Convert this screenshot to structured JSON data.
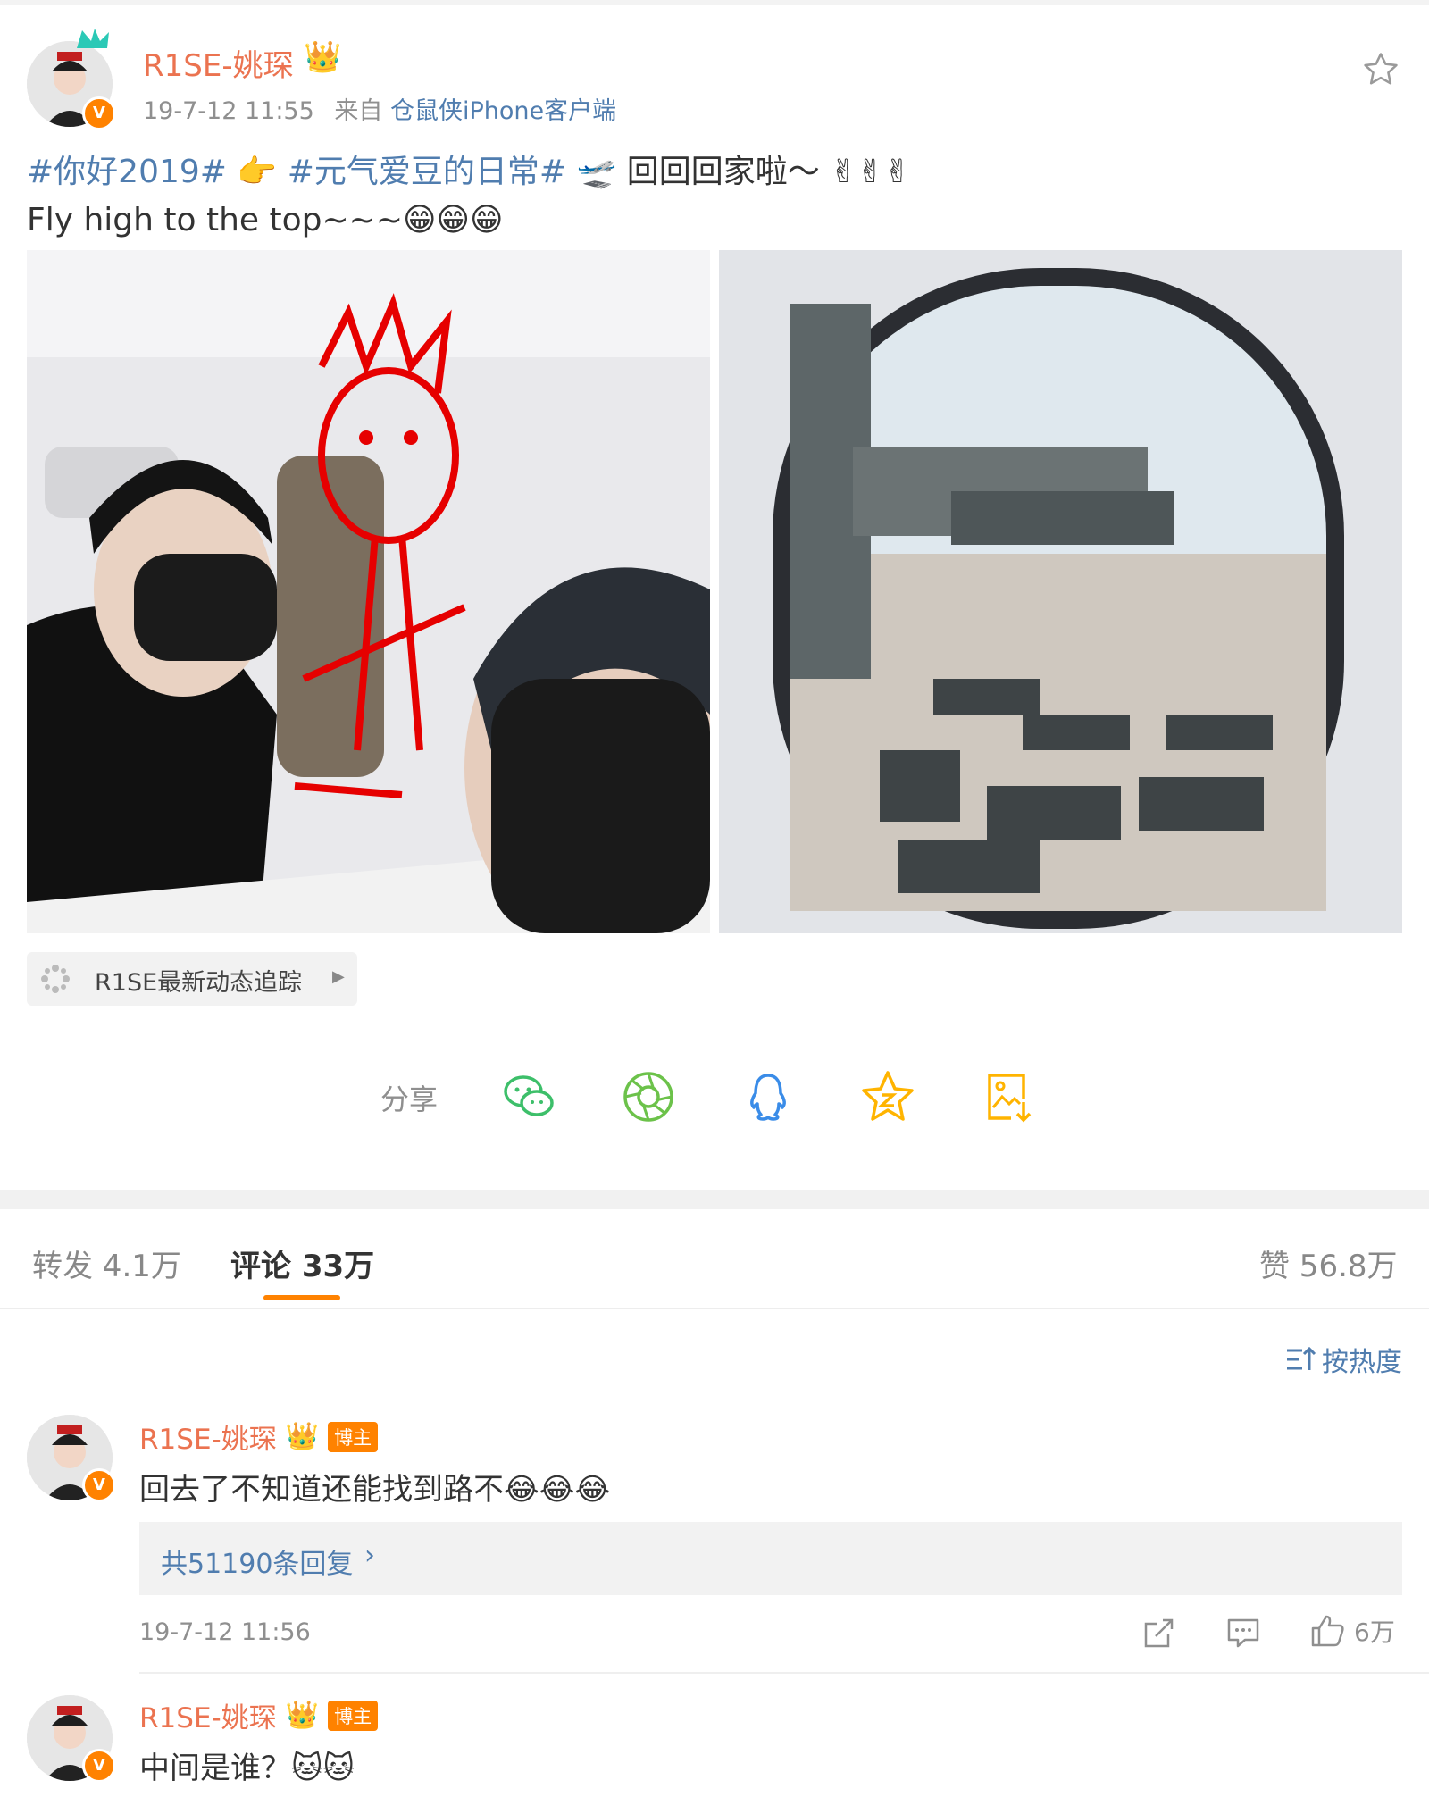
{
  "post": {
    "author": "R1SE-姚琛",
    "timestamp": "19-7-12 11:55",
    "source_prefix": "来自",
    "source": "仓鼠侠iPhone客户端",
    "text_line1": {
      "topic1": "#你好2019#",
      "topic2": "#元气爱豆的日常#",
      "text": "回回回家啦～",
      "emojis": "✌✌✌"
    },
    "text_line2": {
      "text": "Fly high to the top~~~",
      "emojis": "😁😁😁"
    },
    "superchat_link": "R1SE最新动态追踪",
    "share_label": "分享"
  },
  "tabs": {
    "repost": "转发 4.1万",
    "comments": "评论 33万",
    "likes": "赞 56.8万"
  },
  "sort_label": "按热度",
  "comments": [
    {
      "author": "R1SE-姚琛",
      "badge": "博主",
      "text": "回去了不知道还能找到路不",
      "emojis": "😂😂😂",
      "replies": "共51190条回复",
      "time": "19-7-12 11:56",
      "likes": "6万"
    },
    {
      "author": "R1SE-姚琛",
      "badge": "博主",
      "text": "中间是谁？",
      "emojis": "🐱🐱"
    }
  ],
  "colors": {
    "name": "#eb7350",
    "link": "#507daf",
    "accent": "#ff8200",
    "wechat": "#3dbf6a",
    "moments": "#6cc24a",
    "qq": "#3a8ce8",
    "qzone": "#ffb400"
  },
  "icons": [
    "star-outline-icon",
    "wechat-icon",
    "moments-icon",
    "qq-icon",
    "qzone-icon",
    "save-image-icon",
    "sort-icon",
    "share-icon",
    "comment-icon",
    "like-icon"
  ]
}
